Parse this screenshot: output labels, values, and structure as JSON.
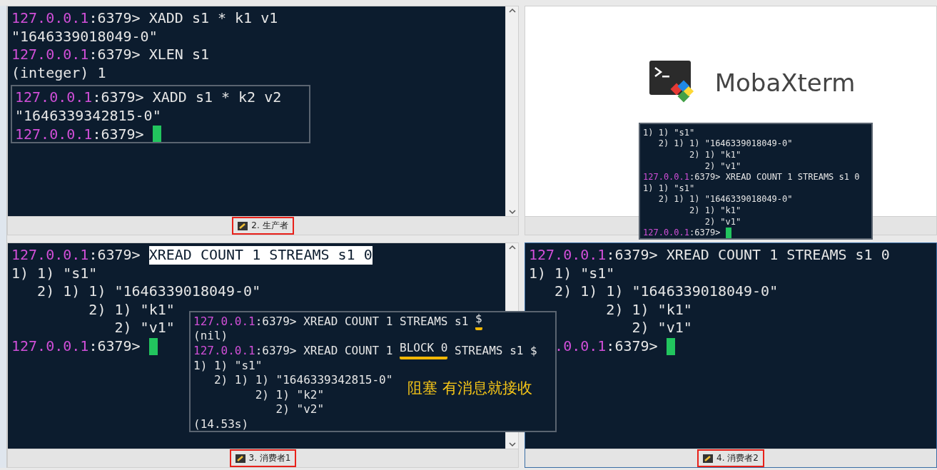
{
  "panes": [
    {
      "kind": "terminal",
      "scrollbar": true,
      "focused": false,
      "tab": {
        "label": "2. 生产者",
        "highlighted": true
      },
      "lines": [
        {
          "kind": "prompt",
          "host": "127.0.0.1",
          "port": ":6379>",
          "command": [
            {
              "text": "XADD s1 * k1 v1"
            }
          ],
          "cursor": false
        },
        {
          "kind": "output",
          "text": "\"1646339018049-0\""
        },
        {
          "kind": "prompt",
          "host": "127.0.0.1",
          "port": ":6379>",
          "command": [
            {
              "text": "XLEN s1"
            }
          ],
          "cursor": false
        },
        {
          "kind": "output",
          "text": "(integer) 1"
        }
      ]
    },
    {
      "kind": "logo",
      "logo_text": "MobaXterm"
    },
    {
      "kind": "terminal",
      "scrollbar": true,
      "focused": false,
      "tab": {
        "label": "3. 消费者1",
        "highlighted": true
      },
      "lines": [
        {
          "kind": "prompt",
          "host": "127.0.0.1",
          "port": ":6379>",
          "command": [
            {
              "text": "XREAD COUNT 1 STREAMS s1 0",
              "selected": true
            }
          ],
          "cursor": false
        },
        {
          "kind": "output",
          "text": "1) 1) \"s1\""
        },
        {
          "kind": "output",
          "text": "   2) 1) 1) \"1646339018049-0\""
        },
        {
          "kind": "output",
          "text": "         2) 1) \"k1\""
        },
        {
          "kind": "output",
          "text": "            2) \"v1\""
        },
        {
          "kind": "prompt",
          "host": "127.0.0.1",
          "port": ":6379>",
          "cursor": true
        }
      ]
    },
    {
      "kind": "terminal",
      "scrollbar": false,
      "focused": true,
      "tab": {
        "label": "4. 消费者2",
        "highlighted": true
      },
      "lines": [
        {
          "kind": "prompt",
          "host": "127.0.0.1",
          "port": ":6379>",
          "command": [
            {
              "text": "XREAD COUNT 1 STREAMS s1 0"
            }
          ],
          "cursor": false
        },
        {
          "kind": "output",
          "text": "1) 1) \"s1\""
        },
        {
          "kind": "output",
          "text": "   2) 1) 1) \"1646339018049-0\""
        },
        {
          "kind": "output",
          "text": "         2) 1) \"k1\""
        },
        {
          "kind": "output",
          "text": "            2) \"v1\""
        },
        {
          "kind": "prompt_partial",
          "host": ".0.0.1",
          "port": ":6379>",
          "cursor": true
        }
      ]
    }
  ],
  "overlays": [
    {
      "lines": [
        {
          "kind": "prompt",
          "host": "127.0.0.1",
          "port": ":6379>",
          "command": [
            {
              "text": "XADD s1 * k2 v2"
            }
          ],
          "cursor": false
        },
        {
          "kind": "output",
          "text": "\"1646339342815-0\""
        },
        {
          "kind": "prompt",
          "host": "127.0.0.1",
          "port": ":6379>",
          "cursor": true
        }
      ]
    },
    {
      "lines": [
        {
          "kind": "output",
          "text": "1) 1) \"s1\""
        },
        {
          "kind": "output",
          "text": "   2) 1) 1) \"1646339018049-0\""
        },
        {
          "kind": "output",
          "text": "         2) 1) \"k1\""
        },
        {
          "kind": "output",
          "text": "            2) \"v1\""
        },
        {
          "kind": "prompt",
          "host": "127.0.0.1",
          "port": ":6379>",
          "command": [
            {
              "text": "XREAD COUNT 1 STREAMS s1 0"
            }
          ],
          "cursor": false
        },
        {
          "kind": "output",
          "text": "1) 1) \"s1\""
        },
        {
          "kind": "output",
          "text": "   2) 1) 1) \"1646339018049-0\""
        },
        {
          "kind": "output",
          "text": "         2) 1) \"k1\""
        },
        {
          "kind": "output",
          "text": "            2) \"v1\""
        },
        {
          "kind": "prompt",
          "host": "127.0.0.1",
          "port": ":6379>",
          "cursor": true
        }
      ]
    },
    {
      "annotation": "阻塞 有消息就接收",
      "lines": [
        {
          "kind": "prompt",
          "host": "127.0.0.1",
          "port": ":6379>",
          "command": [
            {
              "text": "XREAD COUNT 1 STREAMS s1 "
            },
            {
              "text": "$",
              "underlined": true
            }
          ],
          "cursor": false
        },
        {
          "kind": "output",
          "text": "(nil)"
        },
        {
          "kind": "prompt",
          "host": "127.0.0.1",
          "port": ":6379>",
          "command": [
            {
              "text": "XREAD COUNT 1 "
            },
            {
              "text": "BLOCK 0",
              "underlined": true
            },
            {
              "text": " STREAMS s1 $"
            }
          ],
          "cursor": false
        },
        {
          "kind": "output",
          "text": "1) 1) \"s1\""
        },
        {
          "kind": "output",
          "text": "   2) 1) 1) \"1646339342815-0\""
        },
        {
          "kind": "output",
          "text": "         2) 1) \"k2\""
        },
        {
          "kind": "output",
          "text": "            2) \"v2\""
        },
        {
          "kind": "output",
          "text": "(14.53s)"
        }
      ]
    }
  ]
}
